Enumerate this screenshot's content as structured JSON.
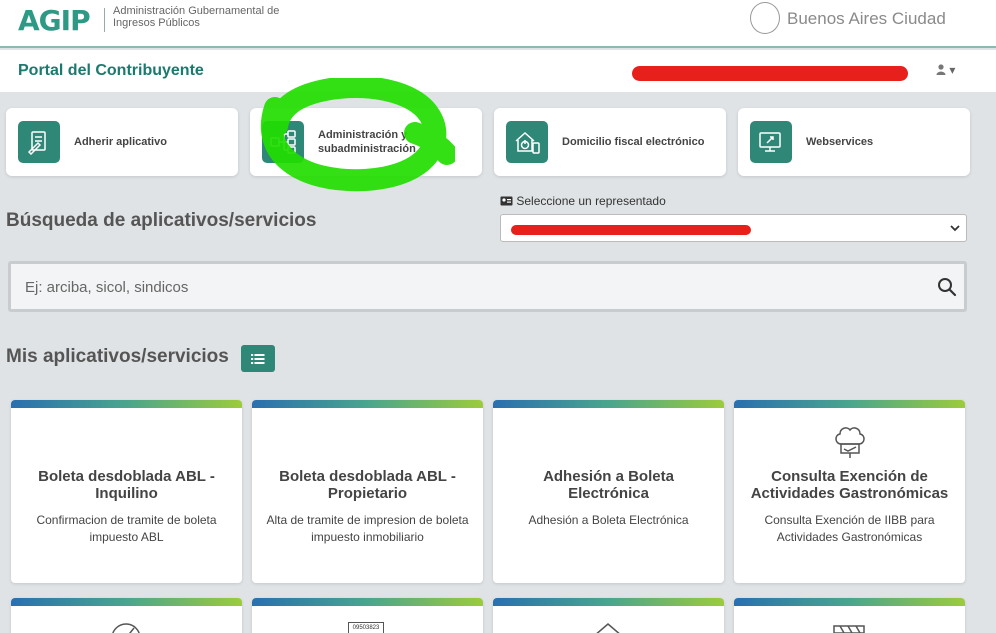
{
  "header": {
    "logo_text": "AGIP",
    "agency_name": "Administración Gubernamental de Ingresos Públicos",
    "city_brand": "Buenos Aires Ciudad"
  },
  "portal": {
    "title": "Portal del Contribuyente",
    "user_menu": "▾"
  },
  "quick_access": [
    {
      "label": "Adherir aplicativo",
      "icon": "document-pen-icon"
    },
    {
      "label": "Administración y subadministración",
      "icon": "org-chart-icon"
    },
    {
      "label": "Domicilio fiscal electrónico",
      "icon": "home-power-icon"
    },
    {
      "label": "Webservices",
      "icon": "monitor-link-icon"
    }
  ],
  "search": {
    "heading": "Búsqueda de aplicativos/servicios",
    "placeholder": "Ej: arciba, sicol, sindicos"
  },
  "representative": {
    "label": "Seleccione un representado"
  },
  "apps": {
    "heading": "Mis aplicativos/servicios",
    "cards": [
      {
        "title": "Boleta desdoblada ABL - Inquilino",
        "description": "Confirmacion de tramite de boleta impuesto ABL",
        "icon": ""
      },
      {
        "title": "Boleta desdoblada ABL - Propietario",
        "description": "Alta de tramite de impresion de boleta impuesto inmobiliario",
        "icon": ""
      },
      {
        "title": "Adhesión a Boleta Electrónica",
        "description": "Adhesión a Boleta Electrónica",
        "icon": ""
      },
      {
        "title": "Consulta Exención de Actividades Gastronómicas",
        "description": "Consulta Exención de IIBB para Actividades Gastronómicas",
        "icon": "chef-hat-icon"
      }
    ],
    "partial_cards": [
      {
        "icon": "gauge-icon"
      },
      {
        "icon": "receipt-icon",
        "icon_text": "09503823"
      },
      {
        "icon": "house-icon"
      },
      {
        "icon": "barrier-icon"
      }
    ]
  },
  "colors": {
    "brand_teal": "#2f8877",
    "redaction": "#e8201c",
    "scribble": "#22dd00"
  }
}
